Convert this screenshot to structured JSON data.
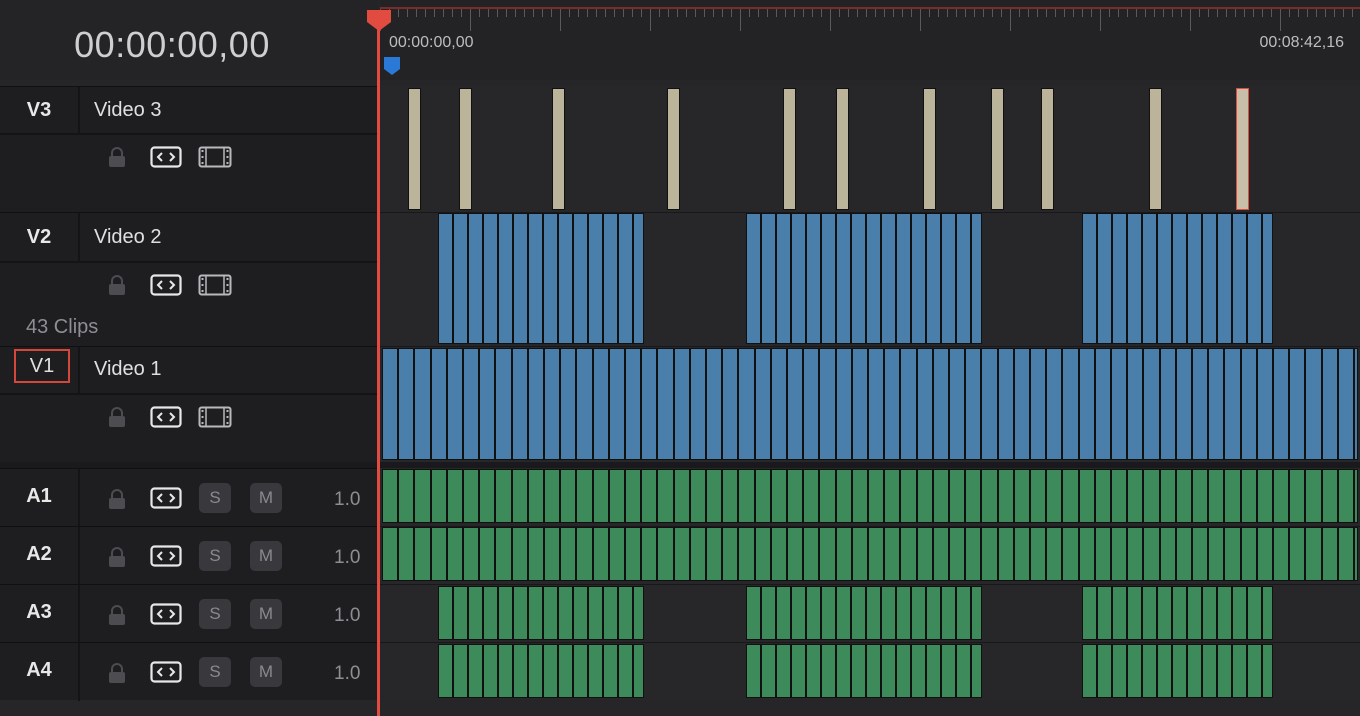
{
  "timecode": "00:00:00,00",
  "ruler": {
    "start_label": "00:00:00,00",
    "end_label": "00:08:42,16"
  },
  "clips_count": "43 Clips",
  "video_tracks": [
    {
      "id": "V3",
      "name": "Video 3"
    },
    {
      "id": "V2",
      "name": "Video 2"
    },
    {
      "id": "V1",
      "name": "Video 1"
    }
  ],
  "audio_tracks": [
    {
      "id": "A1",
      "solo": "S",
      "mute": "M",
      "volume": "1.0"
    },
    {
      "id": "A2",
      "solo": "S",
      "mute": "M",
      "volume": "1.0"
    },
    {
      "id": "A3",
      "solo": "S",
      "mute": "M",
      "volume": "1.0"
    },
    {
      "id": "A4",
      "solo": "S",
      "mute": "M",
      "volume": "1.0"
    }
  ],
  "colors": {
    "video_clip": "#4a7eab",
    "audio_clip": "#3d8a5a",
    "title_clip": "#bcb49a",
    "playhead": "#e14b40",
    "selected": "#e14b40"
  },
  "icons": [
    "lock-icon",
    "auto-select-icon",
    "film-icon"
  ]
}
